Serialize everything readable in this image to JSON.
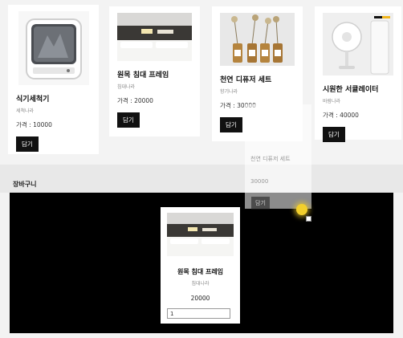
{
  "products": [
    {
      "name": "식기세척기",
      "brand": "세척나라",
      "price_text": "가격 : 10000",
      "button_label": "담기"
    },
    {
      "name": "원목 침대 프레임",
      "brand": "침대나라",
      "price_text": "가격 : 20000",
      "button_label": "담기"
    },
    {
      "name": "천연 디퓨저 세트",
      "brand": "향기나라",
      "price_text": "가격 : 30000",
      "button_label": "담기"
    },
    {
      "name": "시원한 서큘레이터",
      "brand": "바람나라",
      "price_text": "가격 : 40000",
      "button_label": "담기"
    }
  ],
  "drag_ghost": {
    "name": "천연 디퓨저 세트",
    "price_text": "30000",
    "button_label": "담기"
  },
  "cart": {
    "title": "장바구니",
    "items": [
      {
        "name": "원목 침대 프레임",
        "brand": "침대나라",
        "price": "20000",
        "quantity": "1"
      }
    ]
  },
  "colors": {
    "button_bg": "#111111",
    "cart_bg": "#000000",
    "cursor_highlight": "#f2cf2c"
  }
}
